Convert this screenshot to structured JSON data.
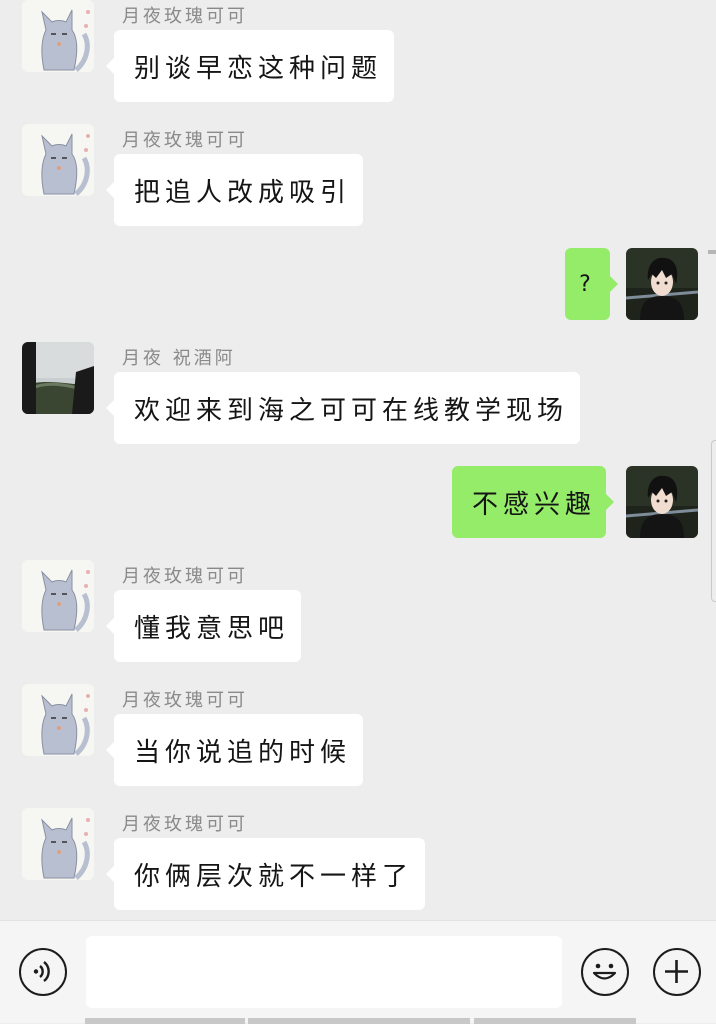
{
  "messages": [
    {
      "side": "left",
      "sender": "月夜玫瑰可可",
      "text": "别谈早恋这种问题",
      "avatar": "cat-avatar"
    },
    {
      "side": "left",
      "sender": "月夜玫瑰可可",
      "text": "把追人改成吸引",
      "avatar": "cat-avatar"
    },
    {
      "side": "right",
      "text": "?",
      "avatar": "anime-avatar"
    },
    {
      "side": "left",
      "sender": "月夜 祝酒阿",
      "text": "欢迎来到海之可可在线教学现场",
      "avatar": "landscape-avatar"
    },
    {
      "side": "right",
      "text": "不感兴趣",
      "avatar": "anime-avatar"
    },
    {
      "side": "left",
      "sender": "月夜玫瑰可可",
      "text": "懂我意思吧",
      "avatar": "cat-avatar"
    },
    {
      "side": "left",
      "sender": "月夜玫瑰可可",
      "text": "当你说追的时候",
      "avatar": "cat-avatar"
    },
    {
      "side": "left",
      "sender": "月夜玫瑰可可",
      "text": "你俩层次就不一样了",
      "avatar": "cat-avatar"
    }
  ],
  "input": {
    "value": ""
  },
  "icons": {
    "voice": "voice-icon",
    "emoji": "emoji-icon",
    "more": "plus-icon"
  },
  "colors": {
    "background": "#ededed",
    "bubble_left": "#ffffff",
    "bubble_right": "#95ec69"
  }
}
